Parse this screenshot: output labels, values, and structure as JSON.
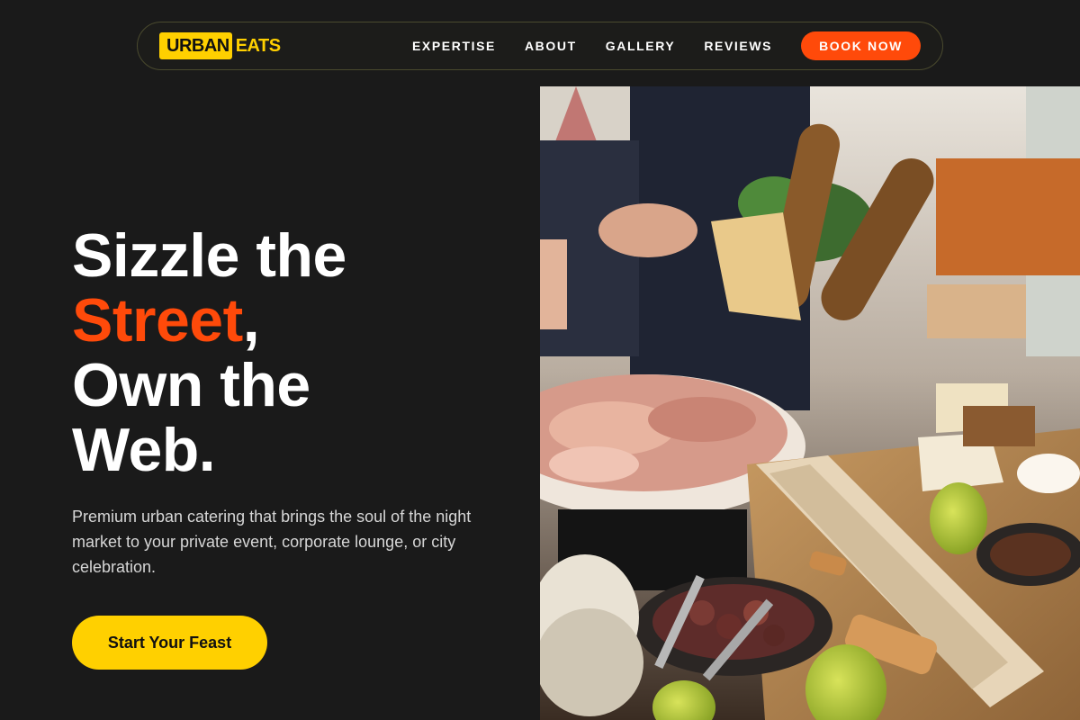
{
  "nav": {
    "logo": {
      "part1": "URBAN",
      "part2": "EATS"
    },
    "links": [
      "EXPERTISE",
      "ABOUT",
      "GALLERY",
      "REVIEWS"
    ],
    "cta": "BOOK NOW"
  },
  "hero": {
    "line1": "Sizzle the",
    "accent": "Street",
    "comma": ",",
    "line3": "Own the",
    "line4": "Web.",
    "description": "Premium urban catering that brings the soul of the night market to your private event, corporate lounge, or city celebration.",
    "cta": "Start Your Feast"
  },
  "colors": {
    "background": "#1a1a1a",
    "brand_yellow": "#ffd000",
    "accent_orange": "#ff4a0a"
  }
}
